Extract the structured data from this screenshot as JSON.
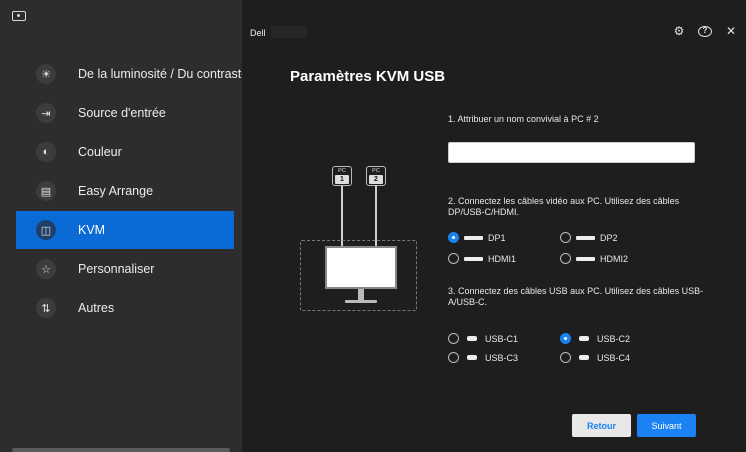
{
  "sidebar": {
    "items": [
      {
        "label": "De la luminosité / Du contraste",
        "icon": "☀"
      },
      {
        "label": "Source d'entrée",
        "icon": "⇥"
      },
      {
        "label": "Couleur",
        "icon": "◐"
      },
      {
        "label": "Easy Arrange",
        "icon": "▤"
      },
      {
        "label": "KVM",
        "icon": "◫"
      },
      {
        "label": "Personnaliser",
        "icon": "☆"
      },
      {
        "label": "Autres",
        "icon": "⇅"
      }
    ],
    "active_index": 4
  },
  "header": {
    "brand": "Dell",
    "settings_icon": "⚙",
    "help_icon": "?",
    "close_icon": "✕"
  },
  "main": {
    "title": "Paramètres KVM USB",
    "illustration": {
      "pc_label": "PC",
      "pc1_number": "1",
      "pc2_number": "2"
    },
    "step1": {
      "label": "1. Attribuer un nom convivial à PC # 2",
      "value": "",
      "placeholder": ""
    },
    "step2": {
      "label": "2. Connectez les câbles vidéo aux PC. Utilisez des câbles DP/USB-C/HDMI.",
      "options": [
        {
          "label": "DP1",
          "selected": true
        },
        {
          "label": "DP2",
          "selected": false
        },
        {
          "label": "HDMI1",
          "selected": false
        },
        {
          "label": "HDMI2",
          "selected": false
        }
      ]
    },
    "step3": {
      "label": "3. Connectez des câbles USB aux PC. Utilisez des câbles USB-A/USB-C.",
      "options": [
        {
          "label": "USB-C1",
          "selected": false
        },
        {
          "label": "USB-C2",
          "selected": true
        },
        {
          "label": "USB-C3",
          "selected": false
        },
        {
          "label": "USB-C4",
          "selected": false
        }
      ]
    },
    "buttons": {
      "back": "Retour",
      "next": "Suivant"
    }
  },
  "colors": {
    "accent": "#1a82f2",
    "active_nav": "#0a6bd6",
    "sidebar_bg": "#2d2d2d",
    "main_bg": "#1e1e1e"
  }
}
